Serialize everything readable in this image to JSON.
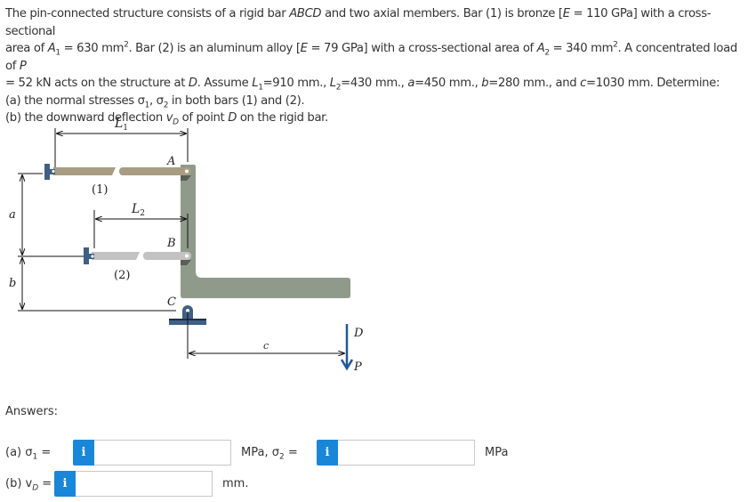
{
  "problem": {
    "line1_a": "The pin-connected structure consists of a rigid bar ",
    "line1_abcd": "ABCD",
    "line1_b": " and two axial members. Bar (1) is bronze [",
    "line1_E": "E",
    "line1_c": " = 110 GPa] with a cross-sectional",
    "line2_a": "area of ",
    "line2_A": "A",
    "line2_sub1": "1",
    "line2_b": " = 630 mm",
    "line2_sup": "2",
    "line2_c": ". Bar (2) is an aluminum alloy [",
    "line2_E": "E",
    "line2_d": " = 79 GPa] with a cross-sectional area of ",
    "line2_A2": "A",
    "line2_sub2": "2",
    "line2_e": " = 340 mm",
    "line2_sup2": "2",
    "line2_f": ". A concentrated load of ",
    "line2_P": "P",
    "line3_a": "= 52 kN acts on the structure at ",
    "line3_D": "D",
    "line3_b": ". Assume ",
    "line3_L": "L",
    "line3_s1": "1",
    "line3_c": "=910 mm., ",
    "line3_L2": "L",
    "line3_s2": "2",
    "line3_d": "=430 mm., ",
    "line3_a_var": "a",
    "line3_e": "=450 mm., ",
    "line3_b_var": "b",
    "line3_f": "=280 mm., and ",
    "line3_c_var": "c",
    "line3_g": "=1030 mm. Determine:",
    "line4_a": "(a) the normal stresses σ",
    "line4_s1": "1",
    "line4_b": ", σ",
    "line4_s2": "2",
    "line4_c": " in both bars (1) and (2).",
    "line5_a": "(b) the downward deflection ",
    "line5_v": "v",
    "line5_sub": "D",
    "line5_b": " of point ",
    "line5_D": "D",
    "line5_c": " on the rigid bar."
  },
  "figure": {
    "labels": {
      "L1": "L",
      "L1_sub": "1",
      "L2": "L",
      "L2_sub": "2",
      "A": "A",
      "B": "B",
      "C": "C",
      "D": "D",
      "P": "P",
      "a": "a",
      "b": "b",
      "c": "c",
      "bar1": "(1)",
      "bar2": "(2)"
    },
    "colors": {
      "bar1": "#a89d84",
      "bar2": "#c2c2c2",
      "rigid": "#8f9a8b",
      "support": "#3f5f86",
      "load": "#1f5796"
    }
  },
  "answers": {
    "label": "Answers:",
    "a_prefix": "(a) σ",
    "a_sub": "1",
    "a_eq": " =",
    "a_unit": "MPa, σ",
    "a2_sub": "2",
    "a2_eq": " =",
    "a2_unit": "MPa",
    "b_prefix": "(b) v",
    "b_sub": "D",
    "b_eq": " =",
    "b_unit": "mm.",
    "info_glyph": "i",
    "sigma1_value": "",
    "sigma2_value": "",
    "vD_value": "",
    "accent": "#1a86d8"
  }
}
